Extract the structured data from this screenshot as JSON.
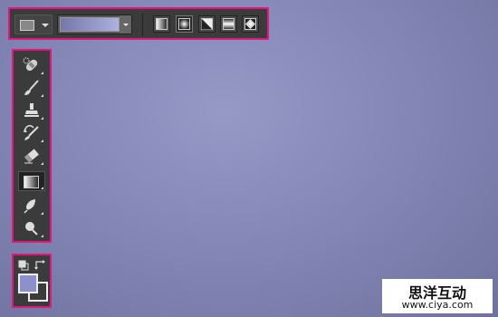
{
  "options_bar": {
    "gradient_preview_colors": [
      "#7477a8",
      "#adb1df"
    ],
    "modes": [
      "linear-gradient",
      "radial-gradient",
      "angle-gradient",
      "reflected-gradient",
      "diamond-gradient"
    ],
    "active_mode": "radial-gradient"
  },
  "tools": [
    "spot-healing-brush",
    "brush",
    "clone-stamp",
    "history-brush",
    "eraser",
    "gradient",
    "blur",
    "dodge"
  ],
  "active_tool": "gradient",
  "colors": {
    "foreground": "#8d91cb",
    "background": "#3b3b3b"
  },
  "canvas": {
    "gradient_center": "#9699c6",
    "gradient_edge": "#6f729e"
  },
  "accent": "#e0177e",
  "watermark": {
    "text": "思洋互动",
    "url": "www.ciya.com"
  }
}
